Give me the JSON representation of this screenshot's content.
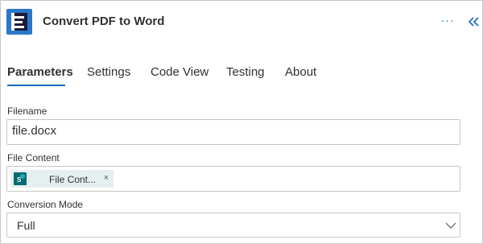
{
  "app": {
    "title": "Convert PDF to Word",
    "icon": "app-logo-icon",
    "accent": "#2b77c9"
  },
  "header": {
    "more_label": "···",
    "collapse_icon": "double-chevron-left-icon"
  },
  "tabs": [
    {
      "label": "Parameters",
      "active": true
    },
    {
      "label": "Settings",
      "active": false
    },
    {
      "label": "Code View",
      "active": false
    },
    {
      "label": "Testing",
      "active": false
    },
    {
      "label": "About",
      "active": false
    }
  ],
  "form": {
    "filename": {
      "label": "Filename",
      "value": "file.docx"
    },
    "file_content": {
      "label": "File Content",
      "token": {
        "label": "File Cont...",
        "icon": "sharepoint-icon",
        "remove": "×"
      }
    },
    "conversion_mode": {
      "label": "Conversion Mode",
      "value": "Full"
    }
  },
  "colors": {
    "tab_underline": "#0f6cbd",
    "token_bg": "#e6efef",
    "sharepoint": "#036c70"
  }
}
